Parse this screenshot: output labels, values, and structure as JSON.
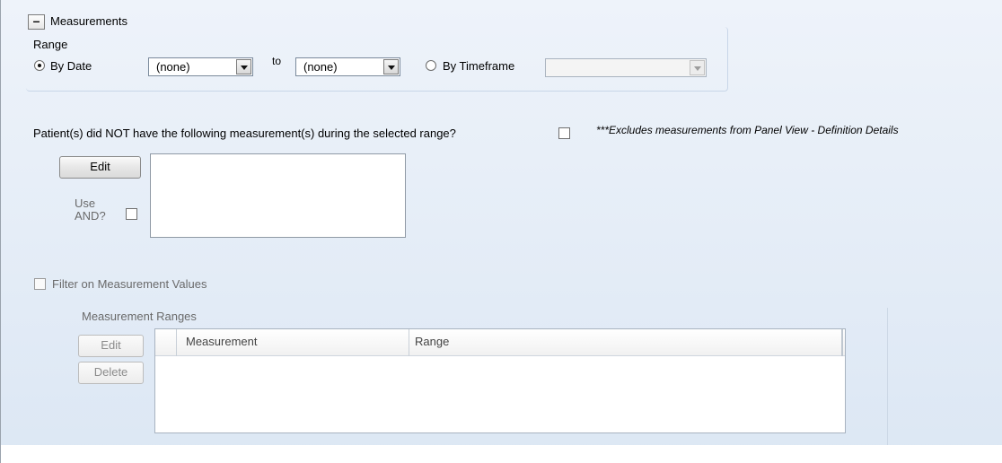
{
  "section": {
    "title": "Measurements",
    "collapse_symbol": "–"
  },
  "range": {
    "label": "Range",
    "by_date_label": "By Date",
    "from_value": "(none)",
    "to_label": "to",
    "to_value": "(none)",
    "by_timeframe_label": "By Timeframe",
    "timeframe_value": "",
    "selected": "By Date"
  },
  "not_measurement": {
    "question": "Patient(s) did NOT have the following measurement(s) during the selected range?",
    "note": "***Excludes measurements from Panel View - Definition Details",
    "edit_label": "Edit",
    "use_and_label_line1": "Use",
    "use_and_label_line2": "AND?",
    "checked": false,
    "use_and_checked": false
  },
  "filter": {
    "label": "Filter on Measurement Values",
    "checked": false,
    "ranges_label": "Measurement Ranges",
    "edit_label": "Edit",
    "delete_label": "Delete",
    "columns": [
      "Measurement",
      "Range"
    ],
    "rows": []
  }
}
